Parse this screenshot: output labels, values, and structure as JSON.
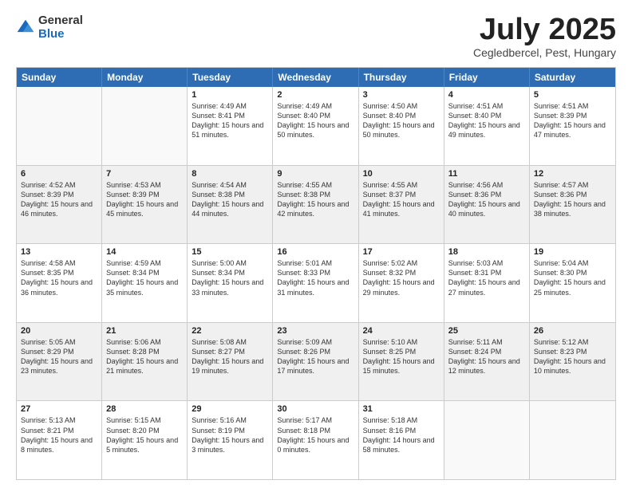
{
  "logo": {
    "general": "General",
    "blue": "Blue"
  },
  "title": "July 2025",
  "location": "Cegledbercel, Pest, Hungary",
  "header_days": [
    "Sunday",
    "Monday",
    "Tuesday",
    "Wednesday",
    "Thursday",
    "Friday",
    "Saturday"
  ],
  "rows": [
    [
      {
        "day": "",
        "sunrise": "",
        "sunset": "",
        "daylight": "",
        "empty": true
      },
      {
        "day": "",
        "sunrise": "",
        "sunset": "",
        "daylight": "",
        "empty": true
      },
      {
        "day": "1",
        "sunrise": "Sunrise: 4:49 AM",
        "sunset": "Sunset: 8:41 PM",
        "daylight": "Daylight: 15 hours and 51 minutes."
      },
      {
        "day": "2",
        "sunrise": "Sunrise: 4:49 AM",
        "sunset": "Sunset: 8:40 PM",
        "daylight": "Daylight: 15 hours and 50 minutes."
      },
      {
        "day": "3",
        "sunrise": "Sunrise: 4:50 AM",
        "sunset": "Sunset: 8:40 PM",
        "daylight": "Daylight: 15 hours and 50 minutes."
      },
      {
        "day": "4",
        "sunrise": "Sunrise: 4:51 AM",
        "sunset": "Sunset: 8:40 PM",
        "daylight": "Daylight: 15 hours and 49 minutes."
      },
      {
        "day": "5",
        "sunrise": "Sunrise: 4:51 AM",
        "sunset": "Sunset: 8:39 PM",
        "daylight": "Daylight: 15 hours and 47 minutes."
      }
    ],
    [
      {
        "day": "6",
        "sunrise": "Sunrise: 4:52 AM",
        "sunset": "Sunset: 8:39 PM",
        "daylight": "Daylight: 15 hours and 46 minutes."
      },
      {
        "day": "7",
        "sunrise": "Sunrise: 4:53 AM",
        "sunset": "Sunset: 8:39 PM",
        "daylight": "Daylight: 15 hours and 45 minutes."
      },
      {
        "day": "8",
        "sunrise": "Sunrise: 4:54 AM",
        "sunset": "Sunset: 8:38 PM",
        "daylight": "Daylight: 15 hours and 44 minutes."
      },
      {
        "day": "9",
        "sunrise": "Sunrise: 4:55 AM",
        "sunset": "Sunset: 8:38 PM",
        "daylight": "Daylight: 15 hours and 42 minutes."
      },
      {
        "day": "10",
        "sunrise": "Sunrise: 4:55 AM",
        "sunset": "Sunset: 8:37 PM",
        "daylight": "Daylight: 15 hours and 41 minutes."
      },
      {
        "day": "11",
        "sunrise": "Sunrise: 4:56 AM",
        "sunset": "Sunset: 8:36 PM",
        "daylight": "Daylight: 15 hours and 40 minutes."
      },
      {
        "day": "12",
        "sunrise": "Sunrise: 4:57 AM",
        "sunset": "Sunset: 8:36 PM",
        "daylight": "Daylight: 15 hours and 38 minutes."
      }
    ],
    [
      {
        "day": "13",
        "sunrise": "Sunrise: 4:58 AM",
        "sunset": "Sunset: 8:35 PM",
        "daylight": "Daylight: 15 hours and 36 minutes."
      },
      {
        "day": "14",
        "sunrise": "Sunrise: 4:59 AM",
        "sunset": "Sunset: 8:34 PM",
        "daylight": "Daylight: 15 hours and 35 minutes."
      },
      {
        "day": "15",
        "sunrise": "Sunrise: 5:00 AM",
        "sunset": "Sunset: 8:34 PM",
        "daylight": "Daylight: 15 hours and 33 minutes."
      },
      {
        "day": "16",
        "sunrise": "Sunrise: 5:01 AM",
        "sunset": "Sunset: 8:33 PM",
        "daylight": "Daylight: 15 hours and 31 minutes."
      },
      {
        "day": "17",
        "sunrise": "Sunrise: 5:02 AM",
        "sunset": "Sunset: 8:32 PM",
        "daylight": "Daylight: 15 hours and 29 minutes."
      },
      {
        "day": "18",
        "sunrise": "Sunrise: 5:03 AM",
        "sunset": "Sunset: 8:31 PM",
        "daylight": "Daylight: 15 hours and 27 minutes."
      },
      {
        "day": "19",
        "sunrise": "Sunrise: 5:04 AM",
        "sunset": "Sunset: 8:30 PM",
        "daylight": "Daylight: 15 hours and 25 minutes."
      }
    ],
    [
      {
        "day": "20",
        "sunrise": "Sunrise: 5:05 AM",
        "sunset": "Sunset: 8:29 PM",
        "daylight": "Daylight: 15 hours and 23 minutes."
      },
      {
        "day": "21",
        "sunrise": "Sunrise: 5:06 AM",
        "sunset": "Sunset: 8:28 PM",
        "daylight": "Daylight: 15 hours and 21 minutes."
      },
      {
        "day": "22",
        "sunrise": "Sunrise: 5:08 AM",
        "sunset": "Sunset: 8:27 PM",
        "daylight": "Daylight: 15 hours and 19 minutes."
      },
      {
        "day": "23",
        "sunrise": "Sunrise: 5:09 AM",
        "sunset": "Sunset: 8:26 PM",
        "daylight": "Daylight: 15 hours and 17 minutes."
      },
      {
        "day": "24",
        "sunrise": "Sunrise: 5:10 AM",
        "sunset": "Sunset: 8:25 PM",
        "daylight": "Daylight: 15 hours and 15 minutes."
      },
      {
        "day": "25",
        "sunrise": "Sunrise: 5:11 AM",
        "sunset": "Sunset: 8:24 PM",
        "daylight": "Daylight: 15 hours and 12 minutes."
      },
      {
        "day": "26",
        "sunrise": "Sunrise: 5:12 AM",
        "sunset": "Sunset: 8:23 PM",
        "daylight": "Daylight: 15 hours and 10 minutes."
      }
    ],
    [
      {
        "day": "27",
        "sunrise": "Sunrise: 5:13 AM",
        "sunset": "Sunset: 8:21 PM",
        "daylight": "Daylight: 15 hours and 8 minutes."
      },
      {
        "day": "28",
        "sunrise": "Sunrise: 5:15 AM",
        "sunset": "Sunset: 8:20 PM",
        "daylight": "Daylight: 15 hours and 5 minutes."
      },
      {
        "day": "29",
        "sunrise": "Sunrise: 5:16 AM",
        "sunset": "Sunset: 8:19 PM",
        "daylight": "Daylight: 15 hours and 3 minutes."
      },
      {
        "day": "30",
        "sunrise": "Sunrise: 5:17 AM",
        "sunset": "Sunset: 8:18 PM",
        "daylight": "Daylight: 15 hours and 0 minutes."
      },
      {
        "day": "31",
        "sunrise": "Sunrise: 5:18 AM",
        "sunset": "Sunset: 8:16 PM",
        "daylight": "Daylight: 14 hours and 58 minutes."
      },
      {
        "day": "",
        "sunrise": "",
        "sunset": "",
        "daylight": "",
        "empty": true
      },
      {
        "day": "",
        "sunrise": "",
        "sunset": "",
        "daylight": "",
        "empty": true
      }
    ]
  ]
}
